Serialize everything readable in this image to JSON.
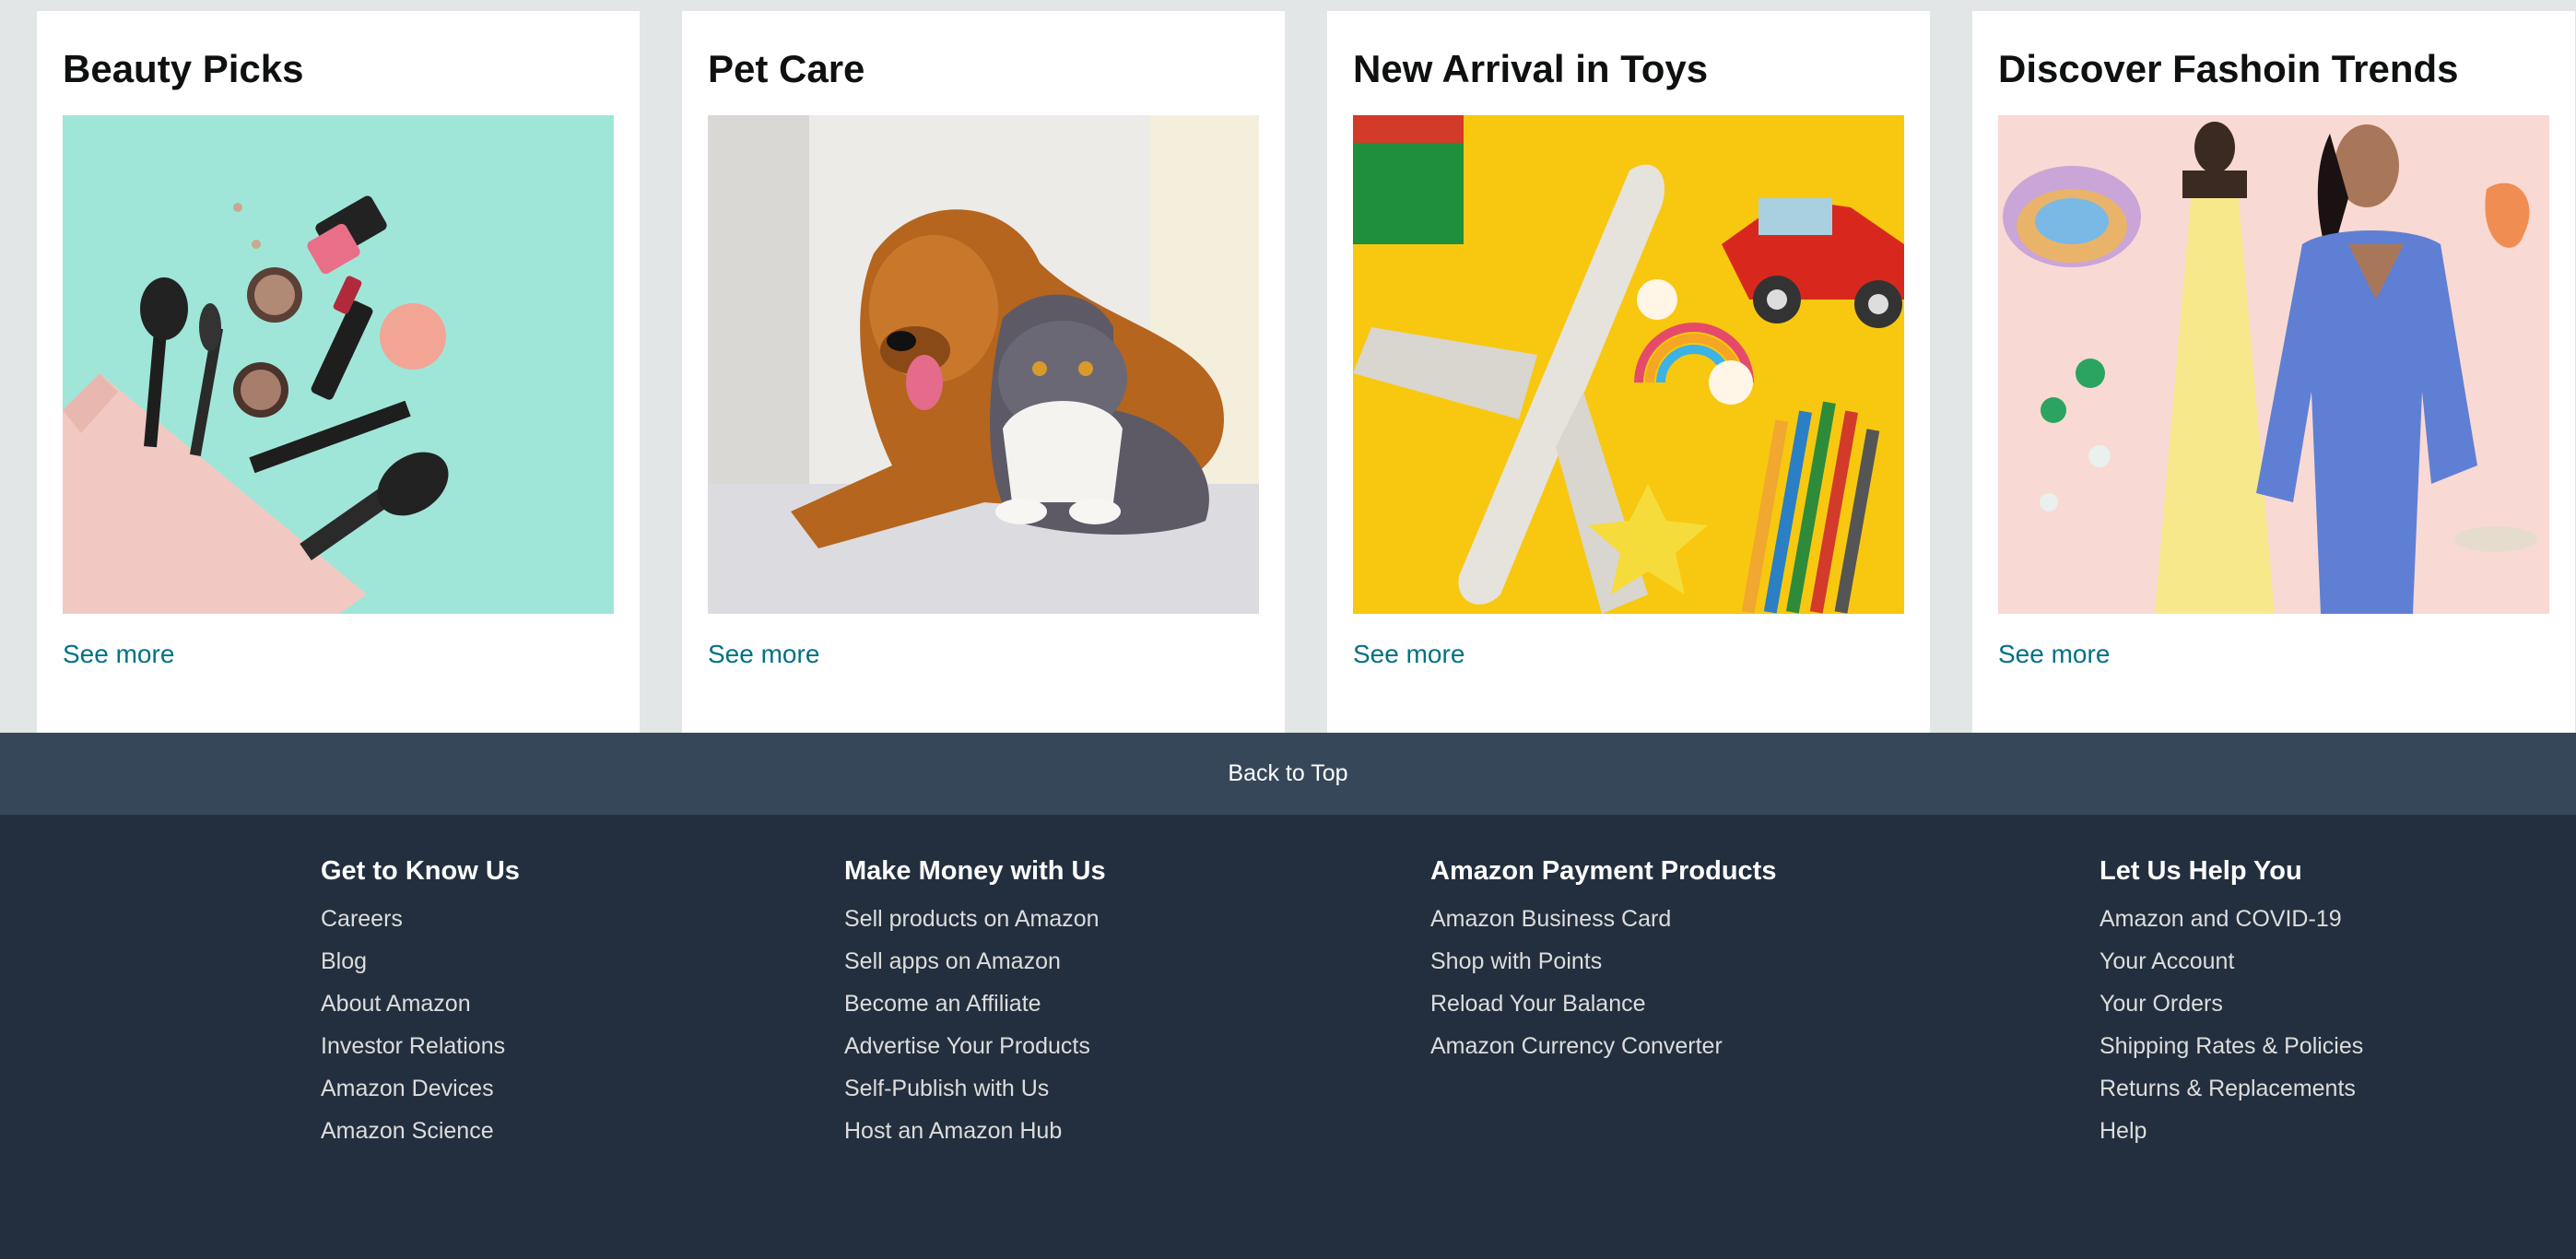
{
  "cards": [
    {
      "title": "Beauty Picks",
      "link": "See more"
    },
    {
      "title": "Pet Care",
      "link": "See more"
    },
    {
      "title": "New Arrival in Toys",
      "link": "See more"
    },
    {
      "title": "Discover Fashoin Trends",
      "link": "See more"
    }
  ],
  "back_to_top": "Back to Top",
  "footer": {
    "columns": [
      {
        "heading": "Get to Know Us",
        "links": [
          "Careers",
          "Blog",
          "About Amazon",
          "Investor Relations",
          "Amazon Devices",
          "Amazon Science"
        ]
      },
      {
        "heading": "Make Money with Us",
        "links": [
          "Sell products on Amazon",
          "Sell apps on Amazon",
          "Become an Affiliate",
          "Advertise Your Products",
          "Self-Publish with Us",
          "Host an Amazon Hub"
        ]
      },
      {
        "heading": "Amazon Payment Products",
        "links": [
          "Amazon Business Card",
          "Shop with Points",
          "Reload Your Balance",
          "Amazon Currency Converter"
        ]
      },
      {
        "heading": "Let Us Help You",
        "links": [
          "Amazon and COVID-19",
          "Your Account",
          "Your Orders",
          "Shipping Rates & Policies",
          "Returns & Replacements",
          "Help"
        ]
      }
    ]
  },
  "colors": {
    "page_bg": "#e3e6e6",
    "link": "#007185",
    "back_to_top_bg": "#37475a",
    "footer_bg": "#232f3e"
  }
}
